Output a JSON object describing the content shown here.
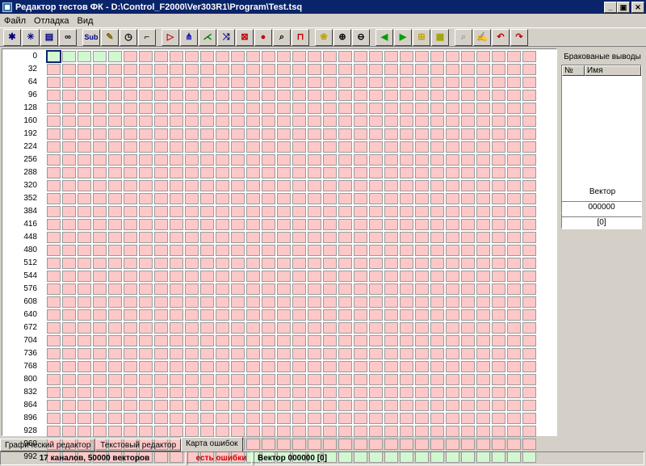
{
  "window": {
    "title": "Редактор тестов ФК - D:\\Control_F2000\\Ver303R1\\Program\\Test.tsq",
    "minimize": "_",
    "maximize": "▣",
    "close": "✕"
  },
  "menu": [
    "Файл",
    "Отладка",
    "Вид"
  ],
  "toolbar": [
    {
      "icon": "bug-icon",
      "glyph": "✱",
      "color": "#000080"
    },
    {
      "icon": "bug-star-icon",
      "glyph": "✳",
      "color": "#000080"
    },
    {
      "icon": "document-icon",
      "glyph": "▤",
      "color": "#000080"
    },
    {
      "icon": "chain-icon",
      "glyph": "∞",
      "color": "#000000"
    },
    {
      "icon": "sub-icon",
      "glyph": "Sub",
      "color": "#000080"
    },
    {
      "icon": "pencil-icon",
      "glyph": "✎",
      "color": "#806000"
    },
    {
      "icon": "clock-icon",
      "glyph": "◷",
      "color": "#000000"
    },
    {
      "icon": "crane-icon",
      "glyph": "⌐",
      "color": "#000000"
    },
    {
      "icon": "play-icon",
      "glyph": "▷",
      "color": "#c00000"
    },
    {
      "icon": "step-icon",
      "glyph": "⋔",
      "color": "#0000c0"
    },
    {
      "icon": "fork-icon",
      "glyph": "⋌",
      "color": "#008000"
    },
    {
      "icon": "branch-icon",
      "glyph": "⤨",
      "color": "#000080"
    },
    {
      "icon": "grid-stop-icon",
      "glyph": "⊠",
      "color": "#c00000"
    },
    {
      "icon": "stop-icon",
      "glyph": "●",
      "color": "#c00000"
    },
    {
      "icon": "search-icon",
      "glyph": "⌕",
      "color": "#000000"
    },
    {
      "icon": "pulse-icon",
      "glyph": "⊓",
      "color": "#c00000"
    },
    {
      "icon": "palette-icon",
      "glyph": "❀",
      "color": "#c0a000"
    },
    {
      "icon": "zoom-in-icon",
      "glyph": "⊕",
      "color": "#000000"
    },
    {
      "icon": "zoom-out-icon",
      "glyph": "⊖",
      "color": "#000000"
    },
    {
      "icon": "arrow-left-icon",
      "glyph": "◀",
      "color": "#00a000"
    },
    {
      "icon": "arrow-right-icon",
      "glyph": "▶",
      "color": "#00a000"
    },
    {
      "icon": "grid-yellow-icon",
      "glyph": "⊞",
      "color": "#c0a000"
    },
    {
      "icon": "grid-green-icon",
      "glyph": "▦",
      "color": "#a0a000"
    },
    {
      "icon": "find-disabled-icon",
      "glyph": "⌕",
      "color": "#a0a0a0"
    },
    {
      "icon": "edit-icon",
      "glyph": "✍",
      "color": "#000000"
    },
    {
      "icon": "undo-icon",
      "glyph": "↶",
      "color": "#c00000"
    },
    {
      "icon": "redo-icon",
      "glyph": "↷",
      "color": "#c00000"
    }
  ],
  "error_map": {
    "channel_labels": [
      "0",
      "32",
      "64",
      "96",
      "128",
      "160",
      "192",
      "224",
      "256",
      "288",
      "320",
      "352",
      "384",
      "416",
      "448",
      "480",
      "512",
      "544",
      "576",
      "608",
      "640",
      "672",
      "704",
      "736",
      "768",
      "800",
      "832",
      "864",
      "896",
      "928",
      "960",
      "992"
    ],
    "columns": 32,
    "good_cells": {
      "0": [
        0,
        1,
        2,
        3,
        4
      ],
      "31": [
        13,
        14,
        15,
        16,
        17,
        18,
        19,
        20,
        21,
        22,
        23,
        24,
        25,
        26,
        27,
        28,
        29,
        30,
        31
      ]
    },
    "selected_cell": [
      0,
      0
    ],
    "colors": {
      "bad": "#ffc8c8",
      "good": "#d2f8d2"
    }
  },
  "right_panel": {
    "title": "Бракованые выводы",
    "col_number": "№",
    "col_name": "Имя",
    "vector_label": "Вектор",
    "vector_value": "000000",
    "vector_index": "[0]"
  },
  "tabs": [
    {
      "label": "Графический редактор",
      "active": false
    },
    {
      "label": "Текстовый редактор",
      "active": false
    },
    {
      "label": "Карта ошибок",
      "active": true
    }
  ],
  "status": {
    "channels": "17 каналов, 50000 векторов",
    "errors": "есть ошибки",
    "vector": "Вектор 000000 [0]"
  }
}
